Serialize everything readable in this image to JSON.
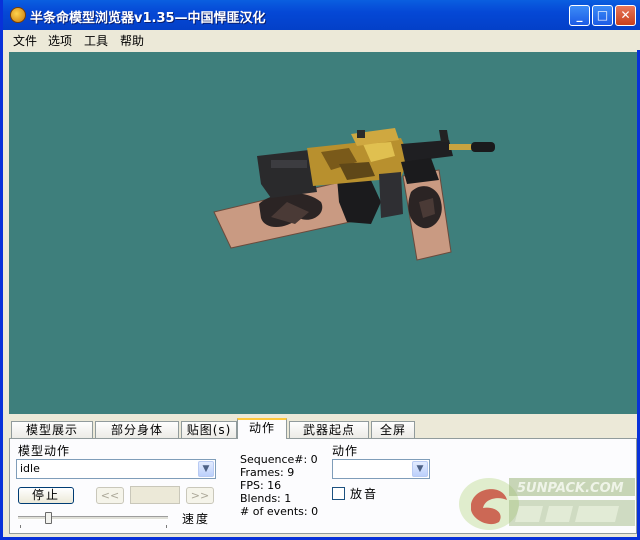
{
  "window": {
    "title": "半条命模型浏览器v1.35—中国悍匪汉化",
    "controls": {
      "minimize": "_",
      "maximize": "□",
      "close": "✕"
    }
  },
  "menu": [
    "文件",
    "选项",
    "工具",
    "帮助"
  ],
  "viewport": {
    "background_color": "#3e7f7c",
    "content": "M4A1 rifle view model with tattooed arms"
  },
  "tabs": [
    {
      "label": "模型展示",
      "active": false
    },
    {
      "label": "部分身体",
      "active": false
    },
    {
      "label": "贴图(s)",
      "active": false
    },
    {
      "label": "动作",
      "active": true
    },
    {
      "label": "武器起点",
      "active": false
    },
    {
      "label": "全屏",
      "active": false
    }
  ],
  "panel": {
    "model_action_label": "模型动作",
    "sequence_value": "idle",
    "stop_button": "停止",
    "prev_button": "<<",
    "next_button": ">>",
    "frame_value": "",
    "speed_label": "速度",
    "speed_fraction": 0.2,
    "stats": [
      "Sequence#: 0",
      "Frames: 9",
      "FPS: 16",
      "Blends: 1",
      "# of events: 0"
    ],
    "action_label": "动作",
    "action_value": "",
    "sound_label": "放音",
    "sound_checked": false
  },
  "watermark": {
    "text": "5UNPACK.COM"
  },
  "colors": {
    "titlebar": "#0548d6",
    "accent_tab": "#ffc83c"
  }
}
